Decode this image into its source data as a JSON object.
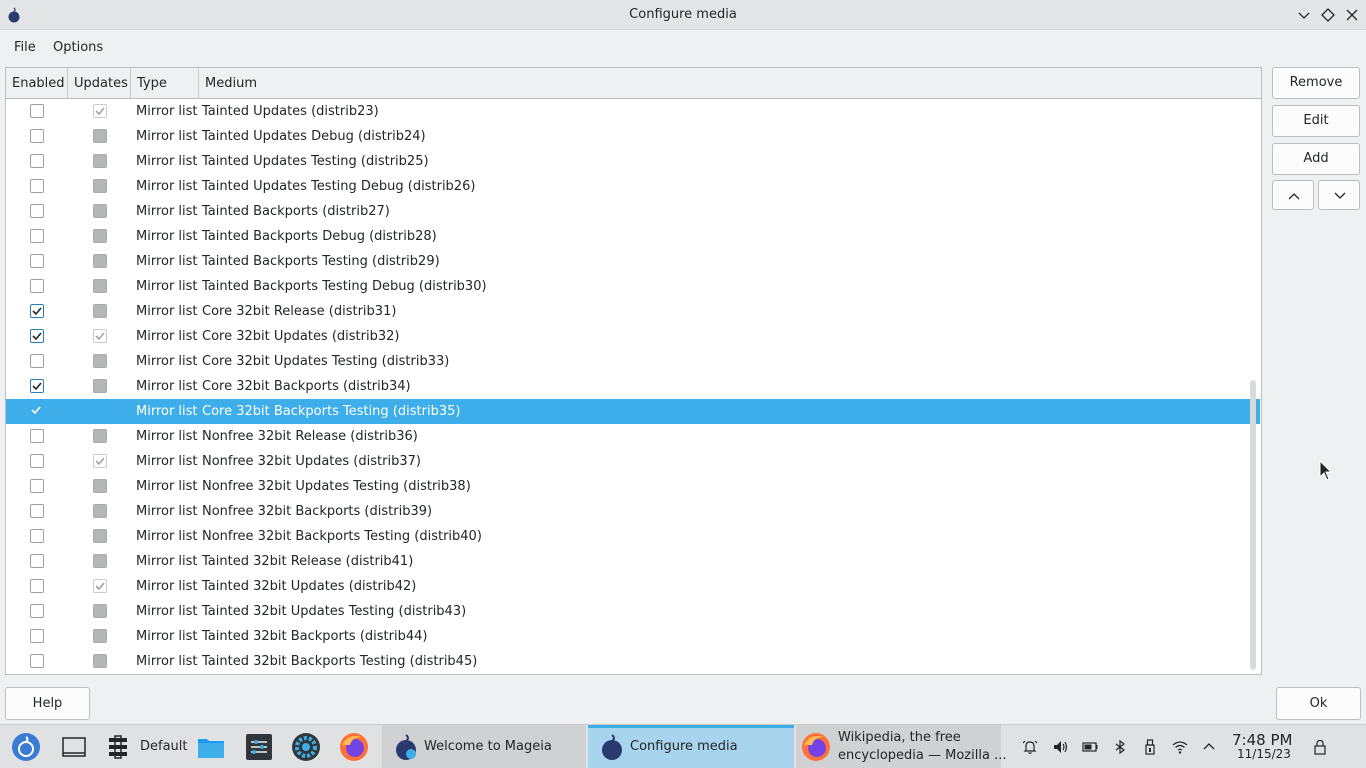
{
  "window": {
    "title": "Configure media"
  },
  "menu": {
    "file": "File",
    "options": "Options"
  },
  "table": {
    "columns": [
      "Enabled",
      "Updates",
      "Type",
      "Medium"
    ],
    "rows": [
      {
        "enabled": false,
        "updates": true,
        "type": "Mirror list",
        "medium": "Tainted Updates (distrib23)"
      },
      {
        "enabled": false,
        "updates": false,
        "type": "Mirror list",
        "medium": "Tainted Updates Debug (distrib24)"
      },
      {
        "enabled": false,
        "updates": false,
        "type": "Mirror list",
        "medium": "Tainted Updates Testing (distrib25)"
      },
      {
        "enabled": false,
        "updates": false,
        "type": "Mirror list",
        "medium": "Tainted Updates Testing Debug (distrib26)"
      },
      {
        "enabled": false,
        "updates": false,
        "type": "Mirror list",
        "medium": "Tainted Backports (distrib27)"
      },
      {
        "enabled": false,
        "updates": false,
        "type": "Mirror list",
        "medium": "Tainted Backports Debug (distrib28)"
      },
      {
        "enabled": false,
        "updates": false,
        "type": "Mirror list",
        "medium": "Tainted Backports Testing (distrib29)"
      },
      {
        "enabled": false,
        "updates": false,
        "type": "Mirror list",
        "medium": "Tainted Backports Testing Debug (distrib30)"
      },
      {
        "enabled": true,
        "updates": false,
        "type": "Mirror list",
        "medium": "Core 32bit Release (distrib31)"
      },
      {
        "enabled": true,
        "updates": true,
        "type": "Mirror list",
        "medium": "Core 32bit Updates (distrib32)"
      },
      {
        "enabled": false,
        "updates": false,
        "type": "Mirror list",
        "medium": "Core 32bit Updates Testing (distrib33)"
      },
      {
        "enabled": true,
        "updates": false,
        "type": "Mirror list",
        "medium": "Core 32bit Backports (distrib34)"
      },
      {
        "enabled": true,
        "updates": false,
        "type": "Mirror list",
        "medium": "Core 32bit Backports Testing (distrib35)",
        "selected": true
      },
      {
        "enabled": false,
        "updates": false,
        "type": "Mirror list",
        "medium": "Nonfree 32bit Release (distrib36)"
      },
      {
        "enabled": false,
        "updates": true,
        "type": "Mirror list",
        "medium": "Nonfree 32bit Updates (distrib37)"
      },
      {
        "enabled": false,
        "updates": false,
        "type": "Mirror list",
        "medium": "Nonfree 32bit Updates Testing (distrib38)"
      },
      {
        "enabled": false,
        "updates": false,
        "type": "Mirror list",
        "medium": "Nonfree 32bit Backports (distrib39)"
      },
      {
        "enabled": false,
        "updates": false,
        "type": "Mirror list",
        "medium": "Nonfree 32bit Backports Testing (distrib40)"
      },
      {
        "enabled": false,
        "updates": false,
        "type": "Mirror list",
        "medium": "Tainted 32bit Release (distrib41)"
      },
      {
        "enabled": false,
        "updates": true,
        "type": "Mirror list",
        "medium": "Tainted 32bit Updates (distrib42)"
      },
      {
        "enabled": false,
        "updates": false,
        "type": "Mirror list",
        "medium": "Tainted 32bit Updates Testing (distrib43)"
      },
      {
        "enabled": false,
        "updates": false,
        "type": "Mirror list",
        "medium": "Tainted 32bit Backports (distrib44)"
      },
      {
        "enabled": false,
        "updates": false,
        "type": "Mirror list",
        "medium": "Tainted 32bit Backports Testing (distrib45)"
      }
    ]
  },
  "buttons": {
    "remove": "Remove",
    "edit": "Edit",
    "add": "Add",
    "help": "Help",
    "ok": "Ok"
  },
  "taskbar": {
    "desktop_label": "Default",
    "tasks": [
      {
        "label": "Welcome to Mageia",
        "active": false
      },
      {
        "label": "Configure media",
        "active": true
      },
      {
        "label_line1": "Wikipedia, the free",
        "label_line2": "encyclopedia — Mozilla ...",
        "active": false
      }
    ],
    "clock_time": "7:48 PM",
    "clock_date": "11/15/23"
  },
  "colors": {
    "selection": "#3daee9",
    "accent": "#2980b9"
  },
  "icons": [
    "mageia-icon",
    "minimize-icon",
    "maximize-icon",
    "close-icon",
    "move-up-icon",
    "move-down-icon",
    "app-launcher-icon",
    "show-desktop-icon",
    "pager-icon",
    "file-manager-icon",
    "system-monitor-icon",
    "settings-icon",
    "firefox-icon",
    "alarm-icon",
    "volume-icon",
    "battery-icon",
    "bluetooth-icon",
    "usb-icon",
    "wifi-icon",
    "tray-expand-icon",
    "lock-icon"
  ]
}
